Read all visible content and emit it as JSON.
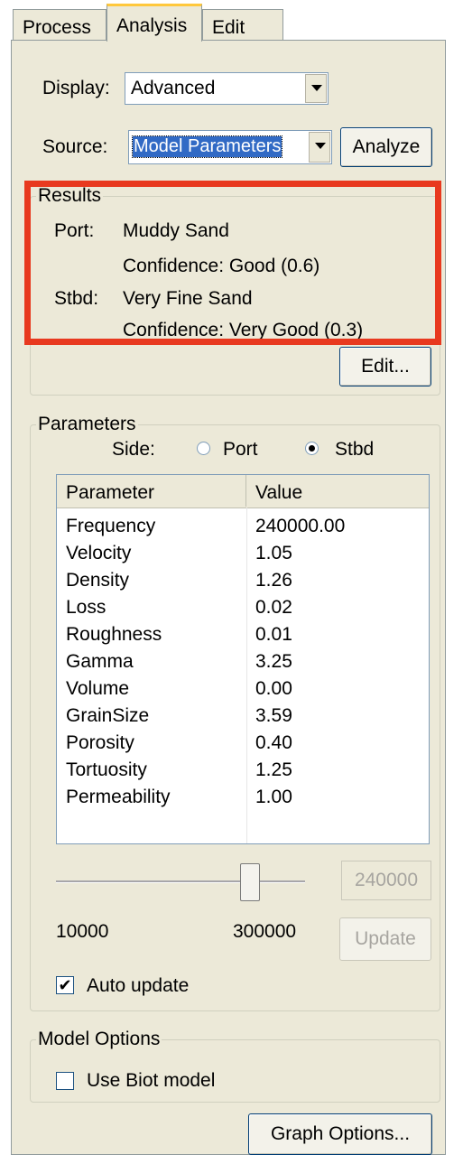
{
  "tabs": [
    "Process",
    "Analysis",
    "Edit"
  ],
  "display": {
    "label": "Display:",
    "value": "Advanced"
  },
  "source": {
    "label": "Source:",
    "value": "Model Parameters",
    "analyze_button": "Analyze"
  },
  "results": {
    "legend": "Results",
    "port_label": "Port:",
    "port_value": "Muddy Sand",
    "port_confidence": "Confidence: Good (0.6)",
    "stbd_label": "Stbd:",
    "stbd_value": "Very Fine Sand",
    "stbd_confidence": "Confidence: Very Good (0.3)",
    "edit_button": "Edit..."
  },
  "parameters": {
    "legend": "Parameters",
    "side_label": "Side:",
    "side_options": [
      "Port",
      "Stbd"
    ],
    "selected_side": "Stbd",
    "columns": [
      "Parameter",
      "Value"
    ],
    "rows": [
      {
        "name": "Frequency",
        "value": "240000.00"
      },
      {
        "name": "Velocity",
        "value": "1.05"
      },
      {
        "name": "Density",
        "value": "1.26"
      },
      {
        "name": "Loss",
        "value": "0.02"
      },
      {
        "name": "Roughness",
        "value": "0.01"
      },
      {
        "name": "Gamma",
        "value": "3.25"
      },
      {
        "name": "Volume",
        "value": "0.00"
      },
      {
        "name": "GrainSize",
        "value": "3.59"
      },
      {
        "name": "Porosity",
        "value": "0.40"
      },
      {
        "name": "Tortuosity",
        "value": "1.25"
      },
      {
        "name": "Permeability",
        "value": "1.00"
      }
    ],
    "slider_min": "10000",
    "slider_max": "300000",
    "slider_value_box": "240000",
    "update_button": "Update",
    "auto_update_label": "Auto update",
    "auto_update_checked": true
  },
  "model_options": {
    "legend": "Model Options",
    "biot_label": "Use Biot model",
    "biot_checked": false
  },
  "graph_options_button": "Graph Options...",
  "colors": {
    "highlight": "#e8391f",
    "panel": "#ece9d8"
  }
}
